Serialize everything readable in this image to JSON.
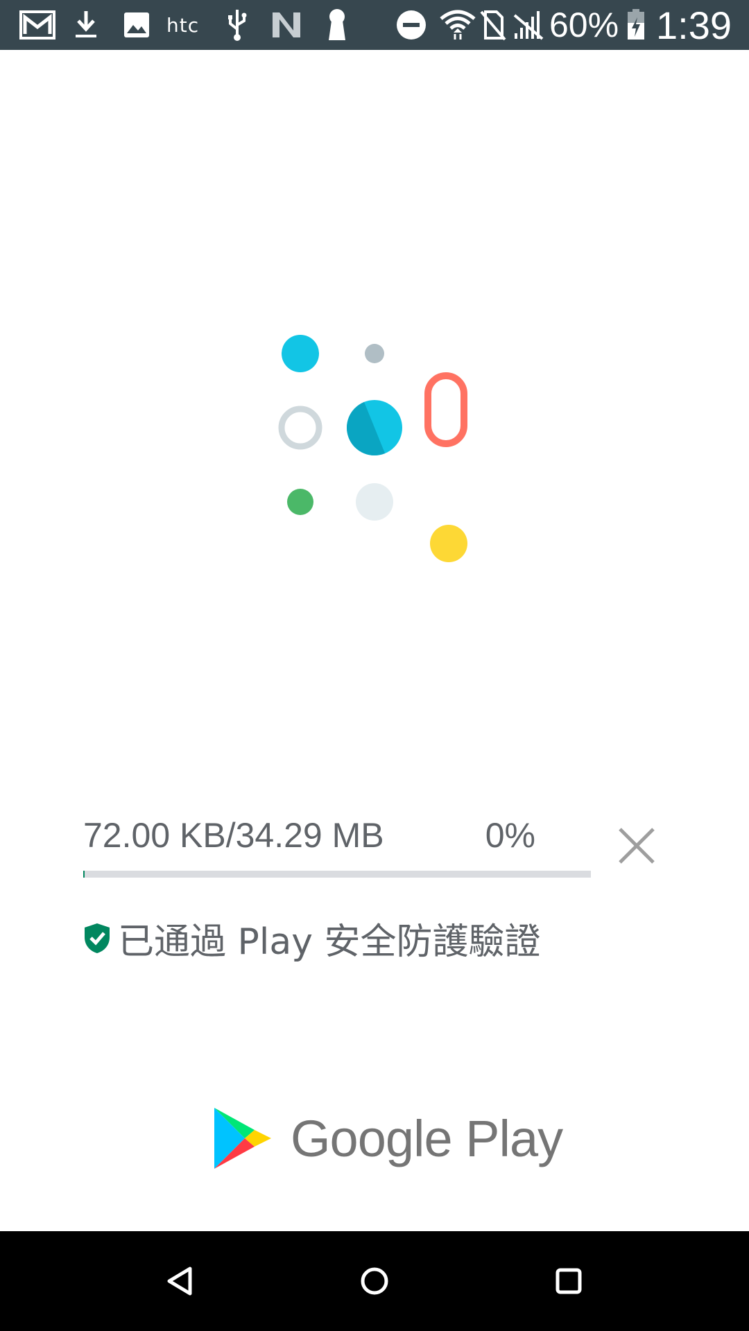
{
  "status_bar": {
    "icons": [
      "gmail-icon",
      "download-icon",
      "gallery-icon",
      "htc-icon",
      "usb-icon",
      "n-icon",
      "keyhole-icon",
      "dnd-icon",
      "wifi-icon",
      "no-sim-icon",
      "no-signal-icon",
      "battery-charging-icon"
    ],
    "htc_label": "htc",
    "battery_percent": "60%",
    "time": "1:39",
    "background": "#37474f"
  },
  "app_logo": {
    "icon": "app-dots-logo",
    "colors": [
      "#12c5e5",
      "#b0bec5",
      "#ff7262",
      "#cfd8dc",
      "#0aa5c2",
      "#4bb868",
      "#e6eef1",
      "#fdd835"
    ]
  },
  "download": {
    "size_text": "72.00 KB/34.29 MB",
    "percent_text": "0%",
    "progress": 0.0021,
    "cancel_icon": "close-icon",
    "track_color": "#dadce0",
    "fill_color": "#01875f"
  },
  "verification": {
    "icon": "shield-check-icon",
    "text": "已通過 Play 安全防護驗證",
    "icon_color": "#01875f"
  },
  "branding": {
    "icon": "google-play-icon",
    "text": "Google Play"
  },
  "nav_bar": {
    "buttons": [
      "back-icon",
      "home-icon",
      "recents-icon"
    ]
  }
}
